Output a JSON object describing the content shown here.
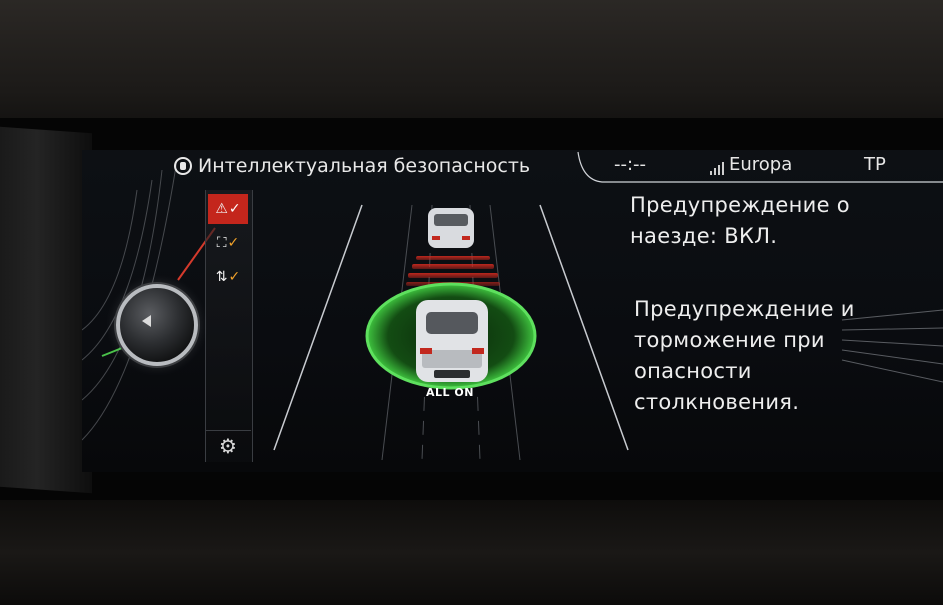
{
  "screen": {
    "title": "Интеллектуальная безопасность",
    "title_icon": "driver-assist-icon"
  },
  "status_bar": {
    "time": "--:--",
    "network": "Europa",
    "signal_icon": "signal-bars-icon",
    "mode": "TP"
  },
  "side_menu": {
    "items": [
      {
        "icon": "collision-warning-icon",
        "checked": true,
        "selected": true
      },
      {
        "icon": "pedestrian-warning-icon",
        "checked": true,
        "selected": false
      },
      {
        "icon": "lane-warning-icon",
        "checked": true,
        "selected": false
      }
    ],
    "settings_icon": "gear-icon"
  },
  "visual": {
    "status_label": "ALL ON",
    "ring_color": "#3fc43f",
    "warning_color": "#d12a1f"
  },
  "info": {
    "line1": "Предупреждение о\nнаезде: ВКЛ.",
    "line2": "Предупреждение и\nторможение при\nопасности\nстолкновения."
  },
  "colors": {
    "accent_red": "#c4261c",
    "check_orange": "#f0a12a",
    "text": "#eeeeee"
  }
}
